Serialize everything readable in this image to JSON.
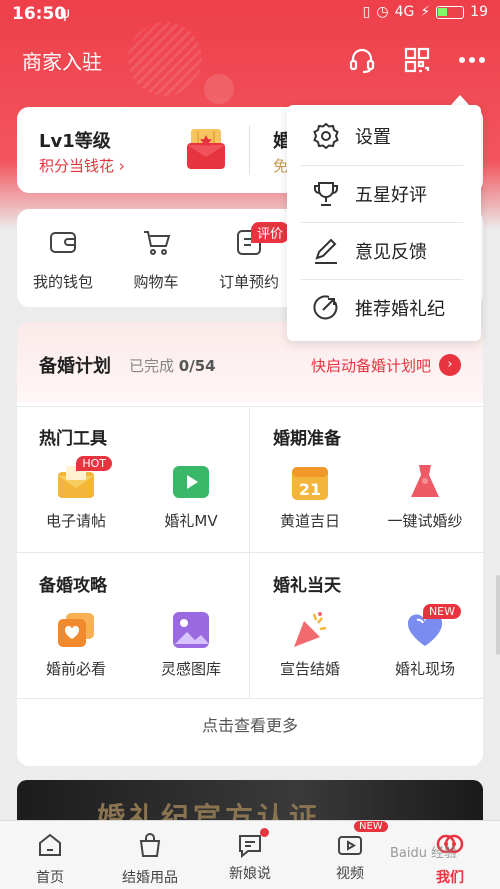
{
  "status_bar": {
    "time": "16:50",
    "network": "4G",
    "battery": "19"
  },
  "nav": {
    "title": "商家入驻"
  },
  "level_card": {
    "level": "Lv1等级",
    "points_link": "积分当钱花 ›",
    "right_title": "婚",
    "right_sub": "免"
  },
  "quick_actions": [
    {
      "label": "我的钱包",
      "icon": "wallet-icon"
    },
    {
      "label": "购物车",
      "icon": "cart-icon"
    },
    {
      "label": "订单预约",
      "icon": "order-icon"
    }
  ],
  "eval_badge": "评价",
  "plan": {
    "title": "备婚计划",
    "progress_label": "已完成",
    "progress_value": "0/54",
    "cta": "快启动备婚计划吧",
    "more": "点击查看更多"
  },
  "sections": [
    {
      "title": "热门工具",
      "items": [
        {
          "label": "电子请帖",
          "tag": "HOT",
          "icon": "invitation-icon"
        },
        {
          "label": "婚礼MV",
          "icon": "video-icon"
        }
      ]
    },
    {
      "title": "婚期准备",
      "items": [
        {
          "label": "黄道吉日",
          "icon": "calendar-icon",
          "date": "21"
        },
        {
          "label": "一键试婚纱",
          "icon": "dress-icon"
        }
      ]
    },
    {
      "title": "备婚攻略",
      "items": [
        {
          "label": "婚前必看",
          "icon": "guide-icon"
        },
        {
          "label": "灵感图库",
          "icon": "gallery-icon"
        }
      ]
    },
    {
      "title": "婚礼当天",
      "items": [
        {
          "label": "宣告结婚",
          "icon": "party-icon"
        },
        {
          "label": "婚礼现场",
          "tag": "NEW",
          "icon": "heart-icon"
        }
      ]
    }
  ],
  "banner": {
    "text": "婚礼纪官方认证"
  },
  "tabs": [
    {
      "label": "首页",
      "icon": "home-icon"
    },
    {
      "label": "结婚用品",
      "icon": "bag-icon"
    },
    {
      "label": "新娘说",
      "icon": "chat-icon"
    },
    {
      "label": "视频",
      "icon": "video-tab-icon",
      "tag": "NEW"
    },
    {
      "label": "我们",
      "icon": "us-icon",
      "active": true
    }
  ],
  "menu": [
    {
      "label": "设置",
      "icon": "gear-icon"
    },
    {
      "label": "五星好评",
      "icon": "trophy-icon"
    },
    {
      "label": "意见反馈",
      "icon": "pencil-icon"
    },
    {
      "label": "推荐婚礼纪",
      "icon": "share-icon"
    }
  ],
  "watermark": "Baidu 经验",
  "colors": {
    "accent": "#e8343f",
    "header": "#ee3f4a"
  }
}
